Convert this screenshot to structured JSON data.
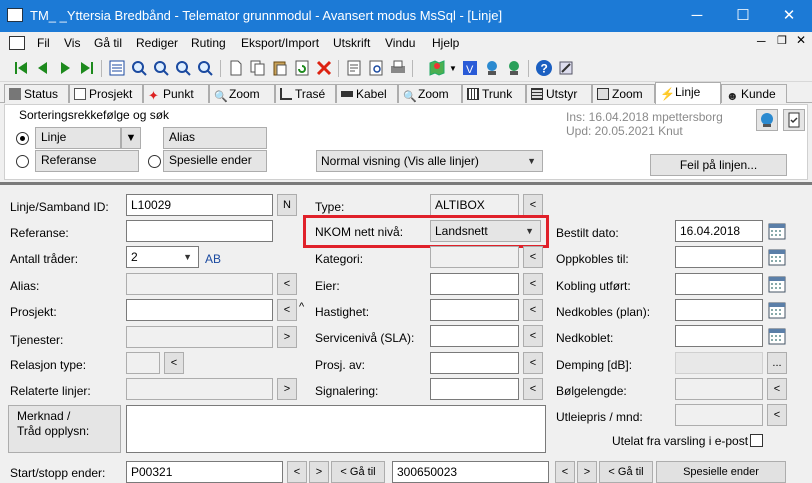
{
  "titlebar": {
    "title": "TM_ _Yttersia Bredbånd   - Telemator grunnmodul - Avansert modus MsSql - [Linje]",
    "minimize": "─",
    "maximize": "☐",
    "close": "✕"
  },
  "menu": [
    "Fil",
    "Vis",
    "Gå til",
    "Rediger",
    "Ruting",
    "Eksport/Import",
    "Utskrift",
    "Vindu",
    "Hjelp"
  ],
  "tabs": [
    "Status",
    "Prosjekt",
    "Punkt",
    "Zoom",
    "Trasé",
    "Kabel",
    "Zoom",
    "Trunk",
    "Utstyr",
    "Zoom",
    "Linje",
    "Kunde"
  ],
  "sort": {
    "legend": "Sorteringsrekkefølge og søk",
    "linje": "Linje",
    "alias": "Alias",
    "referanse": "Referanse",
    "spesielle": "Spesielle ender",
    "visning": "Normal visning (Vis alle linjer)",
    "ins": "Ins: 16.04.2018 mpettersborg",
    "upd": "Upd: 20.05.2021 Knut",
    "feil": "Feil på linjen..."
  },
  "form": {
    "linje_id_label": "Linje/Samband ID:",
    "linje_id_value": "L10029",
    "n_btn": "N",
    "referanse_label": "Referanse:",
    "antall_label": "Antall tråder:",
    "antall_value": "2",
    "ab": "AB",
    "alias_label": "Alias:",
    "prosjekt_label": "Prosjekt:",
    "tjenester_label": "Tjenester:",
    "relasjon_label": "Relasjon type:",
    "relaterte_label": "Relaterte linjer:",
    "merknad_label": "Merknad /\nTråd opplysn:",
    "start_label": "Start/stopp ender:",
    "start_value": "P00321",
    "stop_value": "300650023",
    "gatil": "< Gå til",
    "spesielle_btn": "Spesielle ender",
    "type_label": "Type:",
    "type_value": "ALTIBOX",
    "nkom_label": "NKOM nett nivå:",
    "nkom_value": "Landsnett",
    "kategori_label": "Kategori:",
    "eier_label": "Eier:",
    "hastighet_label": "Hastighet:",
    "serviceniva_label": "Servicenivå (SLA):",
    "prosj_av_label": "Prosj. av:",
    "signalering_label": "Signalering:",
    "bestilt_label": "Bestilt dato:",
    "bestilt_value": "16.04.2018",
    "oppkobles_label": "Oppkobles til:",
    "kobling_label": "Kobling utført:",
    "nedkobles_plan_label": "Nedkobles (plan):",
    "nedkoblet_label": "Nedkoblet:",
    "demping_label": "Demping [dB]:",
    "bolgelengde_label": "Bølgelengde:",
    "utleiepris_label": "Utleiepris / mnd:",
    "utelat_label": "Utelat fra varsling i e-post",
    "lt": "<",
    "gt": ">",
    "dots": "...",
    "up": "^"
  }
}
